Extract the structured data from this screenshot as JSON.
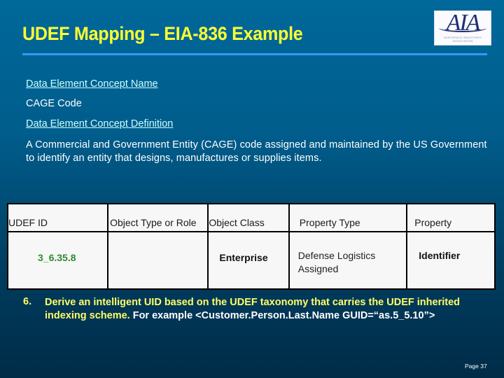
{
  "slide": {
    "title": "UDEF Mapping – EIA-836 Example",
    "logo": {
      "letters": "AIA",
      "subtitle": "AEROSPACE INDUSTRIES ASSOCIATION"
    },
    "colors": {
      "title": "#ffff33",
      "rule": "#3399ff",
      "link": "#ccffff",
      "udef_id": "#2e8b2e",
      "highlight": "#ffff66"
    },
    "concept_name_label": "Data Element Concept Name",
    "concept_name_value": "CAGE Code",
    "concept_definition_label": "Data Element Concept Definition",
    "concept_definition_value": "A Commercial and Government Entity (CAGE) code assigned and maintained by the US Government to identify an entity that designs, manufactures or supplies items.",
    "table": {
      "headers": [
        "UDEF ID",
        "Object Type or Role",
        "Object Class",
        "Property Type",
        "Property"
      ],
      "row": {
        "udef_id": "3_6.35.8",
        "object_type_or_role": "",
        "object_class": "Enterprise",
        "property_type": "Defense Logistics Assigned",
        "property": "Identifier"
      }
    },
    "bullet": {
      "number": "6.",
      "highlight_text": "Derive an intelligent UID based on the UDEF taxonomy that carries the UDEF inherited indexing scheme.",
      "normal_text": " For example <Customer.Person.Last.Name GUID=“as.5_5.10”>"
    },
    "page_label": "Page 37"
  }
}
